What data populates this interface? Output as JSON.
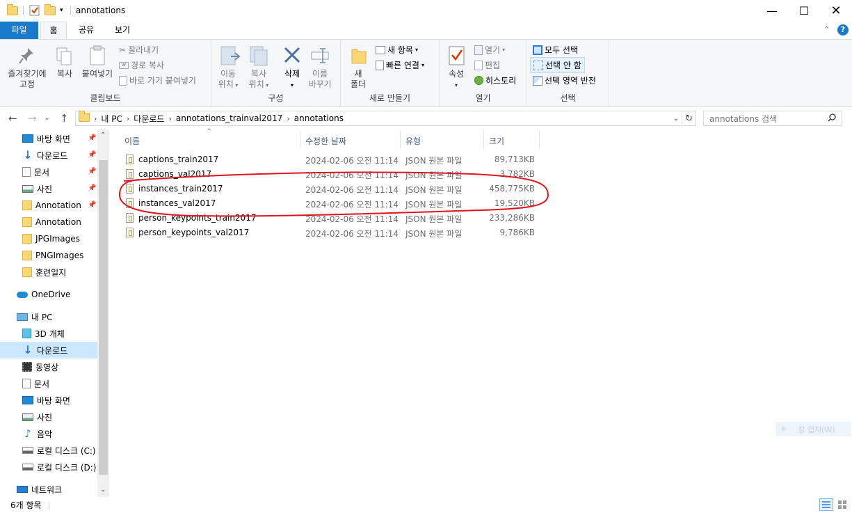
{
  "window": {
    "title": "annotations"
  },
  "ribbon_tabs": [
    "파일",
    "홈",
    "공유",
    "보기"
  ],
  "ribbon": {
    "clipboard": {
      "group": "클립보드",
      "pin": "즐겨찾기에\n고정",
      "pin_l1": "즐겨찾기에",
      "pin_l2": "고정",
      "copy": "복사",
      "paste": "붙여넣기",
      "cut": "잘라내기",
      "copy_path": "경로 복사",
      "paste_shortcut": "바로 가기 붙여넣기"
    },
    "organize": {
      "group": "구성",
      "move_l1": "이동",
      "move_l2": "위치",
      "copyto_l1": "복사",
      "copyto_l2": "위치",
      "delete": "삭제",
      "rename_l1": "이름",
      "rename_l2": "바꾸기"
    },
    "new": {
      "group": "새로 만들기",
      "folder_l1": "새",
      "folder_l2": "폴더",
      "new_item": "새 항목",
      "easy_access": "빠른 연결"
    },
    "open": {
      "group": "열기",
      "properties": "속성",
      "open": "열기",
      "edit": "편집",
      "history": "히스토리"
    },
    "select": {
      "group": "선택",
      "select_all": "모두 선택",
      "select_none": "선택 안 함",
      "invert": "선택 영역 반전"
    }
  },
  "address": {
    "crumbs": [
      "내 PC",
      "다운로드",
      "annotations_trainval2017",
      "annotations"
    ],
    "search_placeholder": "annotations 검색"
  },
  "nav": {
    "quick": [
      {
        "label": "바탕 화면",
        "icon": "desktop-icon",
        "pinned": true
      },
      {
        "label": "다운로드",
        "icon": "download-icon",
        "pinned": true
      },
      {
        "label": "문서",
        "icon": "document-icon",
        "pinned": true
      },
      {
        "label": "사진",
        "icon": "pictures-icon",
        "pinned": true
      },
      {
        "label": "Annotation",
        "icon": "folder-icon",
        "pinned": true
      },
      {
        "label": "Annotation",
        "icon": "folder-icon",
        "pinned": false
      },
      {
        "label": "JPGImages",
        "icon": "folder-icon",
        "pinned": false
      },
      {
        "label": "PNGImages",
        "icon": "folder-icon",
        "pinned": false
      },
      {
        "label": "훈련일지",
        "icon": "folder-icon",
        "pinned": false
      }
    ],
    "onedrive": "OneDrive",
    "thispc": "내 PC",
    "pc_items": [
      {
        "label": "3D 개체",
        "icon": "3d-objects-icon"
      },
      {
        "label": "다운로드",
        "icon": "download-icon"
      },
      {
        "label": "동영상",
        "icon": "video-icon"
      },
      {
        "label": "문서",
        "icon": "document-icon"
      },
      {
        "label": "바탕 화면",
        "icon": "desktop-icon"
      },
      {
        "label": "사진",
        "icon": "pictures-icon"
      },
      {
        "label": "음악",
        "icon": "music-icon"
      },
      {
        "label": "로컬 디스크 (C:)",
        "icon": "drive-icon"
      },
      {
        "label": "로컬 디스크 (D:)",
        "icon": "drive-icon"
      }
    ],
    "network": "네트워크"
  },
  "columns": {
    "name": "이름",
    "date": "수정한 날짜",
    "type": "유형",
    "size": "크기"
  },
  "files": [
    {
      "name": "captions_train2017",
      "date": "2024-02-06 오전 11:14",
      "type": "JSON 원본 파일",
      "size": "89,713KB"
    },
    {
      "name": "captions_val2017",
      "date": "2024-02-06 오전 11:14",
      "type": "JSON 원본 파일",
      "size": "3,782KB"
    },
    {
      "name": "instances_train2017",
      "date": "2024-02-06 오전 11:14",
      "type": "JSON 원본 파일",
      "size": "458,775KB"
    },
    {
      "name": "instances_val2017",
      "date": "2024-02-06 오전 11:14",
      "type": "JSON 원본 파일",
      "size": "19,520KB"
    },
    {
      "name": "person_keypoints_train2017",
      "date": "2024-02-06 오전 11:14",
      "type": "JSON 원본 파일",
      "size": "233,286KB"
    },
    {
      "name": "person_keypoints_val2017",
      "date": "2024-02-06 오전 11:14",
      "type": "JSON 원본 파일",
      "size": "9,786KB"
    }
  ],
  "status": {
    "count": "6개 항목"
  },
  "overlay": {
    "snip": "창 캡처(W)"
  },
  "colors": {
    "file_tab": "#1979ca",
    "selected_nav": "#cce8ff",
    "annotation_circle": "#e0141e"
  }
}
